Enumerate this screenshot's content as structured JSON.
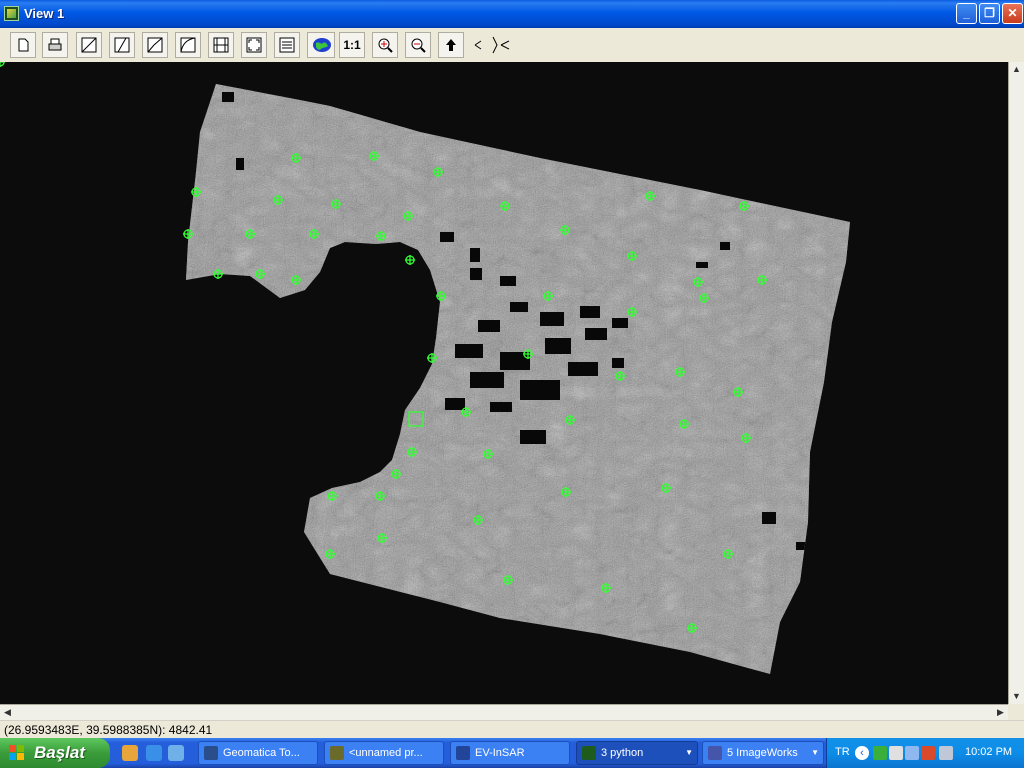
{
  "window": {
    "title": "View 1",
    "minimize": "_",
    "restore": "❐",
    "close": "✕"
  },
  "toolbar": {
    "buttons": [
      {
        "name": "new-icon"
      },
      {
        "name": "print-icon"
      },
      {
        "name": "enhance-linear-icon"
      },
      {
        "name": "enhance-root-icon"
      },
      {
        "name": "enhance-adaptive-icon"
      },
      {
        "name": "enhance-log-icon"
      },
      {
        "name": "enhance-equalize-icon"
      },
      {
        "name": "fit-view-icon"
      },
      {
        "name": "layers-list-icon"
      },
      {
        "name": "overview-globe-icon"
      },
      {
        "name": "zoom-1to1-button",
        "label": "1:1"
      },
      {
        "name": "zoom-in-icon"
      },
      {
        "name": "zoom-out-icon"
      },
      {
        "name": "pan-up-icon"
      },
      {
        "name": "pan-arrows-icon"
      }
    ]
  },
  "status": {
    "coordinates": "(26.9593483E, 39.5988385N): 4842.41"
  },
  "taskbar": {
    "start_label": "Başlat",
    "tasks": [
      {
        "label": "Geomatica To...",
        "color": "#2a4d8c"
      },
      {
        "label": "<unnamed pr...",
        "color": "#6a6a2a"
      },
      {
        "label": "EV-InSAR",
        "color": "#224499"
      },
      {
        "label": "3 python",
        "color": "#1d5c1d",
        "active": true,
        "grouped": true
      },
      {
        "label": "5 ImageWorks",
        "color": "#4455aa",
        "grouped": true
      }
    ],
    "language": "TR",
    "clock": "10:02 PM"
  }
}
